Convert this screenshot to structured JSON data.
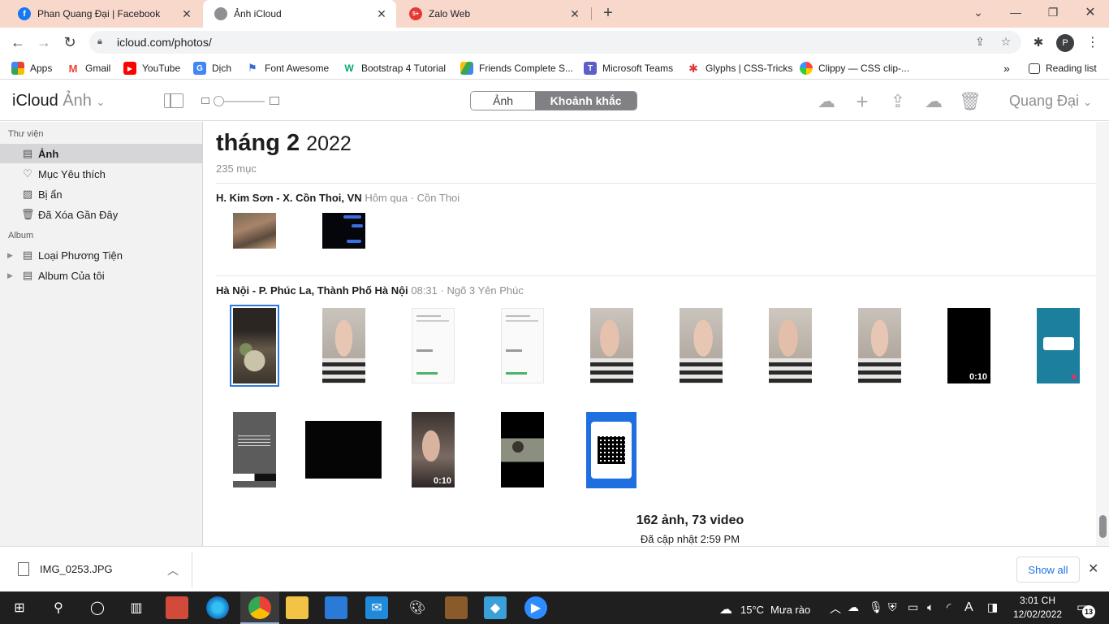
{
  "browser": {
    "tabs": [
      {
        "title": "Phan Quang Đại | Facebook",
        "icon": "facebook-icon",
        "color": "#1877f2"
      },
      {
        "title": "Ảnh iCloud",
        "icon": "apple-icon",
        "color": "#555555"
      },
      {
        "title": "Zalo Web",
        "icon": "zalo-icon",
        "color": "#e53935",
        "badge": "5+"
      }
    ],
    "url": "icloud.com/photos/",
    "profile_initial": "P",
    "bookmarks": [
      {
        "label": "Apps",
        "icon": "apps-grid-icon"
      },
      {
        "label": "Gmail",
        "icon": "gmail-icon"
      },
      {
        "label": "YouTube",
        "icon": "youtube-icon"
      },
      {
        "label": "Dịch",
        "icon": "translate-icon"
      },
      {
        "label": "Font Awesome",
        "icon": "font-awesome-icon"
      },
      {
        "label": "Bootstrap 4 Tutorial",
        "icon": "w3schools-icon"
      },
      {
        "label": "Friends Complete S...",
        "icon": "google-drive-icon"
      },
      {
        "label": "Microsoft Teams",
        "icon": "teams-icon"
      },
      {
        "label": "Glyphs | CSS-Tricks",
        "icon": "css-tricks-icon"
      },
      {
        "label": "Clippy — CSS clip-...",
        "icon": "clippy-icon"
      }
    ],
    "more_bookmarks": "»",
    "reading_list": "Reading list"
  },
  "icloud": {
    "brand": "iCloud",
    "app": "Ảnh",
    "segments": [
      "Ảnh",
      "Khoảnh khắc"
    ],
    "active_segment": "Khoảnh khắc",
    "user": "Quang Đại"
  },
  "sidebar": {
    "library_heading": "Thư viện",
    "library_items": [
      {
        "label": "Ảnh",
        "icon": "photos-icon",
        "selected": true
      },
      {
        "label": "Mục Yêu thích",
        "icon": "heart-icon"
      },
      {
        "label": "Bị ẩn",
        "icon": "hidden-icon"
      },
      {
        "label": "Đã Xóa Gần Đây",
        "icon": "trash-icon"
      }
    ],
    "album_heading": "Album",
    "album_items": [
      {
        "label": "Loại Phương Tiện",
        "icon": "folder-stack-icon"
      },
      {
        "label": "Album Của tôi",
        "icon": "folder-stack-icon"
      }
    ]
  },
  "main": {
    "month": "tháng 2",
    "year": "2022",
    "count": "235 mục",
    "moments": [
      {
        "location": "H. Kim Sơn - X. Cồn Thoi, VN",
        "time": "Hôm qua",
        "place": "Cồn Thoi"
      },
      {
        "location": "Hà Nội - P. Phúc La, Thành Phố Hà Nội",
        "time": "08:31",
        "place": "Ngõ 3 Yên Phúc"
      }
    ],
    "separator": "·",
    "video_durations": [
      "0:10",
      "0:10"
    ],
    "summary": "162 ảnh, 73 video",
    "updated": "Đã cập nhật 2:59 PM"
  },
  "downloads": {
    "file": "IMG_0253.JPG",
    "show_all": "Show all"
  },
  "taskbar": {
    "temperature": "15°C",
    "weather": "Mưa rào",
    "time": "3:01 CH",
    "date": "12/02/2022",
    "notifications": "13",
    "lang": "A"
  }
}
